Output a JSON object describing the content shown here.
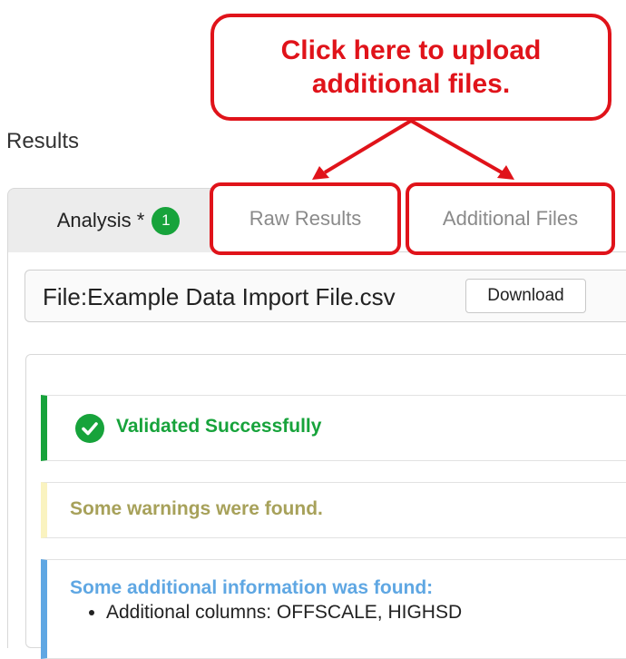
{
  "callout": {
    "line1": "Click here to upload",
    "line2": "additional files."
  },
  "section_title": "Results",
  "tabs": {
    "analysis": {
      "label": "Analysis *",
      "badge": "1"
    },
    "raw_results": {
      "label": "Raw Results"
    },
    "additional_files": {
      "label": "Additional Files"
    }
  },
  "file": {
    "name": "File:Example Data Import File.csv",
    "download_label": "Download"
  },
  "alerts": {
    "success": "Validated Successfully",
    "warning": "Some warnings were found.",
    "info_title": "Some additional information was found:",
    "info_items": [
      "Additional columns: OFFSCALE, HIGHSD"
    ]
  },
  "colors": {
    "annotation_red": "#e0131a",
    "success_green": "#17a33b",
    "warning_olive": "#a7a15a",
    "info_blue": "#5fa7e3"
  }
}
